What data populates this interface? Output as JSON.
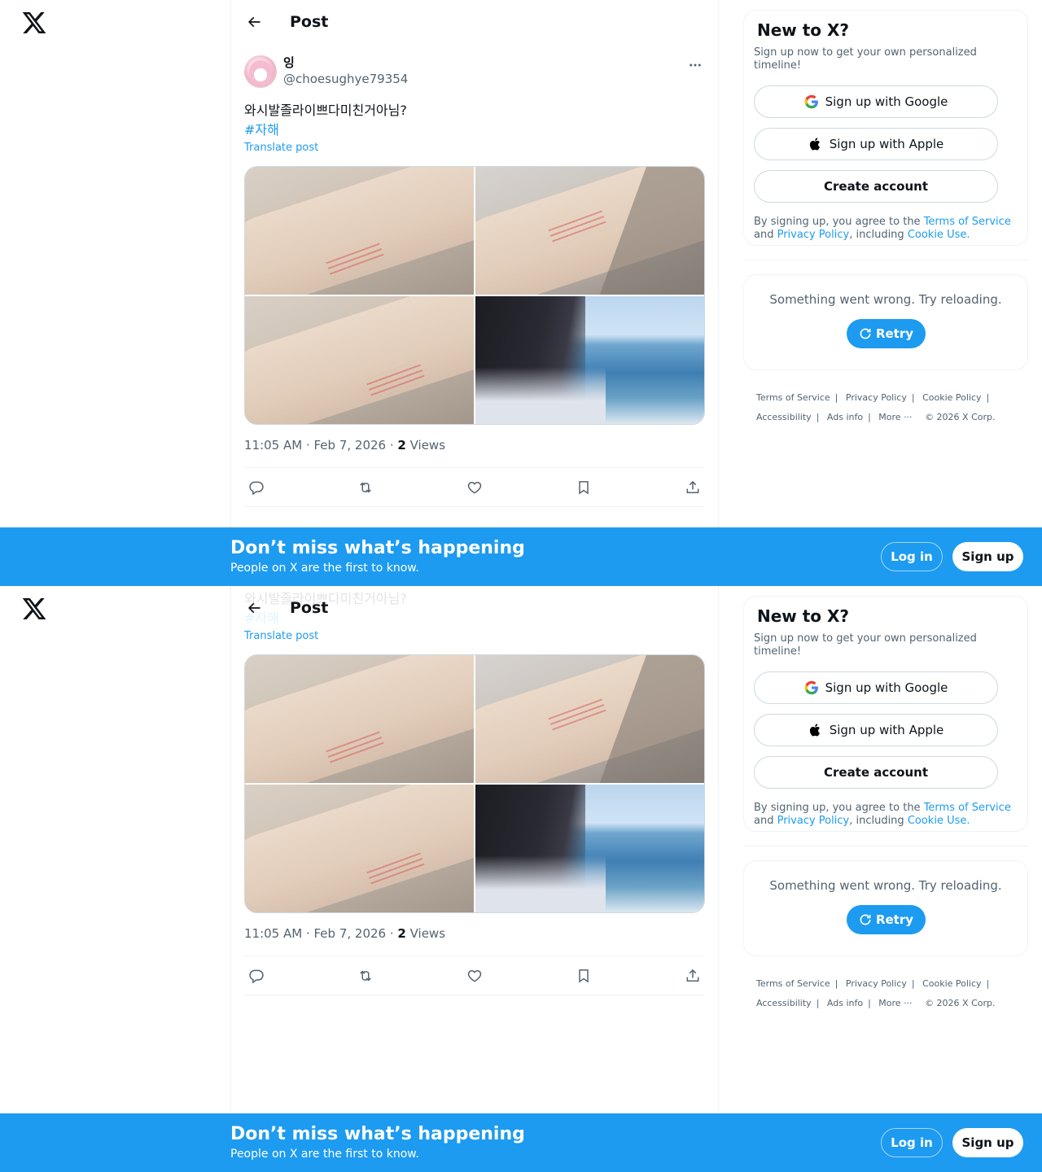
{
  "header": {
    "title": "Post"
  },
  "post": {
    "display_name": "잉",
    "handle": "@choesughye79354",
    "text": "와시발졸라이쁘다미친거아님?",
    "hashtag": "#자해",
    "translate": "Translate post",
    "time": "11:05 AM · Feb 7, 2026 · ",
    "views_count": "2",
    "views_label": " Views",
    "media": [
      "arm-photo-1",
      "arm-photo-2",
      "arm-photo-3",
      "sea-photo"
    ]
  },
  "icons": {
    "logo": "x-logo-icon",
    "back": "arrow-left-icon",
    "more": "more-horizontal-icon",
    "reply": "reply-icon",
    "repost": "repost-icon",
    "like": "heart-icon",
    "bookmark": "bookmark-icon",
    "share": "share-icon"
  },
  "signup_card": {
    "title": "New to X?",
    "subtitle": "Sign up now to get your own personalized timeline!",
    "google": "Sign up with Google",
    "apple": "Sign up with Apple",
    "create": "Create account",
    "terms_prefix": "By signing up, you agree to the ",
    "terms_link": "Terms of Service",
    "terms_and": " and ",
    "privacy_link": "Privacy Policy",
    "terms_including": ", including ",
    "cookie_link": "Cookie Use."
  },
  "error_card": {
    "message": "Something went wrong. Try reloading.",
    "retry": "Retry"
  },
  "footer": {
    "links": [
      "Terms of Service",
      "Privacy Policy",
      "Cookie Policy",
      "Accessibility",
      "Ads info",
      "More ···"
    ],
    "copyright": "© 2026 X Corp."
  },
  "banner": {
    "headline": "Don’t miss what’s happening",
    "subline": "People on X are the first to know.",
    "login": "Log in",
    "signup": "Sign up"
  },
  "colors": {
    "accent": "#1d9bf0",
    "text": "#0f1419",
    "muted": "#536471",
    "border": "#eff3f4"
  }
}
